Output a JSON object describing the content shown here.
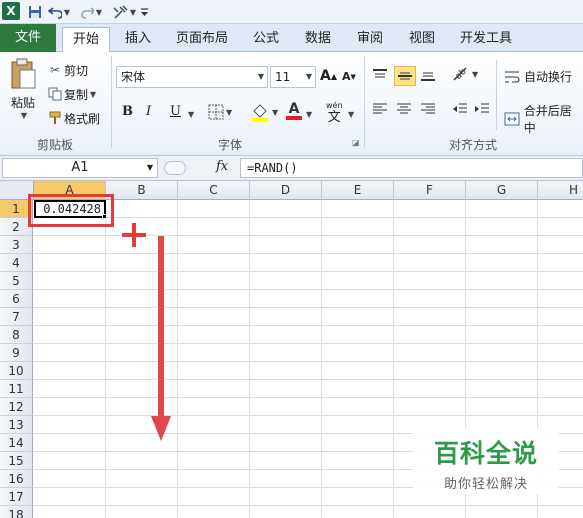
{
  "qat": {
    "logo": "X",
    "save_icon": "save-icon",
    "undo_icon": "undo-icon",
    "redo_icon": "redo-icon",
    "customize_icon": "customize-icon"
  },
  "tabs": [
    {
      "label": "文件"
    },
    {
      "label": "开始"
    },
    {
      "label": "插入"
    },
    {
      "label": "页面布局"
    },
    {
      "label": "公式"
    },
    {
      "label": "数据"
    },
    {
      "label": "审阅"
    },
    {
      "label": "视图"
    },
    {
      "label": "开发工具"
    }
  ],
  "active_tab": "开始",
  "clipboard": {
    "paste": "粘贴",
    "cut": "剪切",
    "copy": "复制",
    "format_painter": "格式刷",
    "group": "剪贴板"
  },
  "font": {
    "name": "宋体",
    "size": "11",
    "bold": "B",
    "italic": "I",
    "underline": "U",
    "group": "字体",
    "grow": "A",
    "shrink": "A",
    "font_color_letter": "A",
    "wen": "wén",
    "wen_char": "文"
  },
  "alignment": {
    "wrap": "自动换行",
    "merge": "合并后居中",
    "group": "对齐方式"
  },
  "formula_bar": {
    "name_box": "A1",
    "fx": "fx",
    "formula": "=RAND()"
  },
  "columns": [
    "A",
    "B",
    "C",
    "D",
    "E",
    "F",
    "G",
    "H"
  ],
  "rows": [
    "1",
    "2",
    "3",
    "4",
    "5",
    "6",
    "7",
    "8",
    "9",
    "10",
    "11",
    "12",
    "13",
    "14",
    "15",
    "16",
    "17",
    "18"
  ],
  "cell_a1_value": "0.042428",
  "selected_cell": "A1",
  "watermark": {
    "title": "百科全说",
    "subtitle": "助你轻松解决"
  },
  "colors": {
    "file_tab": "#2d7a3f",
    "annotation": "#e43c3c",
    "watermark": "#2f9b47",
    "selection_header": "#f6c96a"
  }
}
